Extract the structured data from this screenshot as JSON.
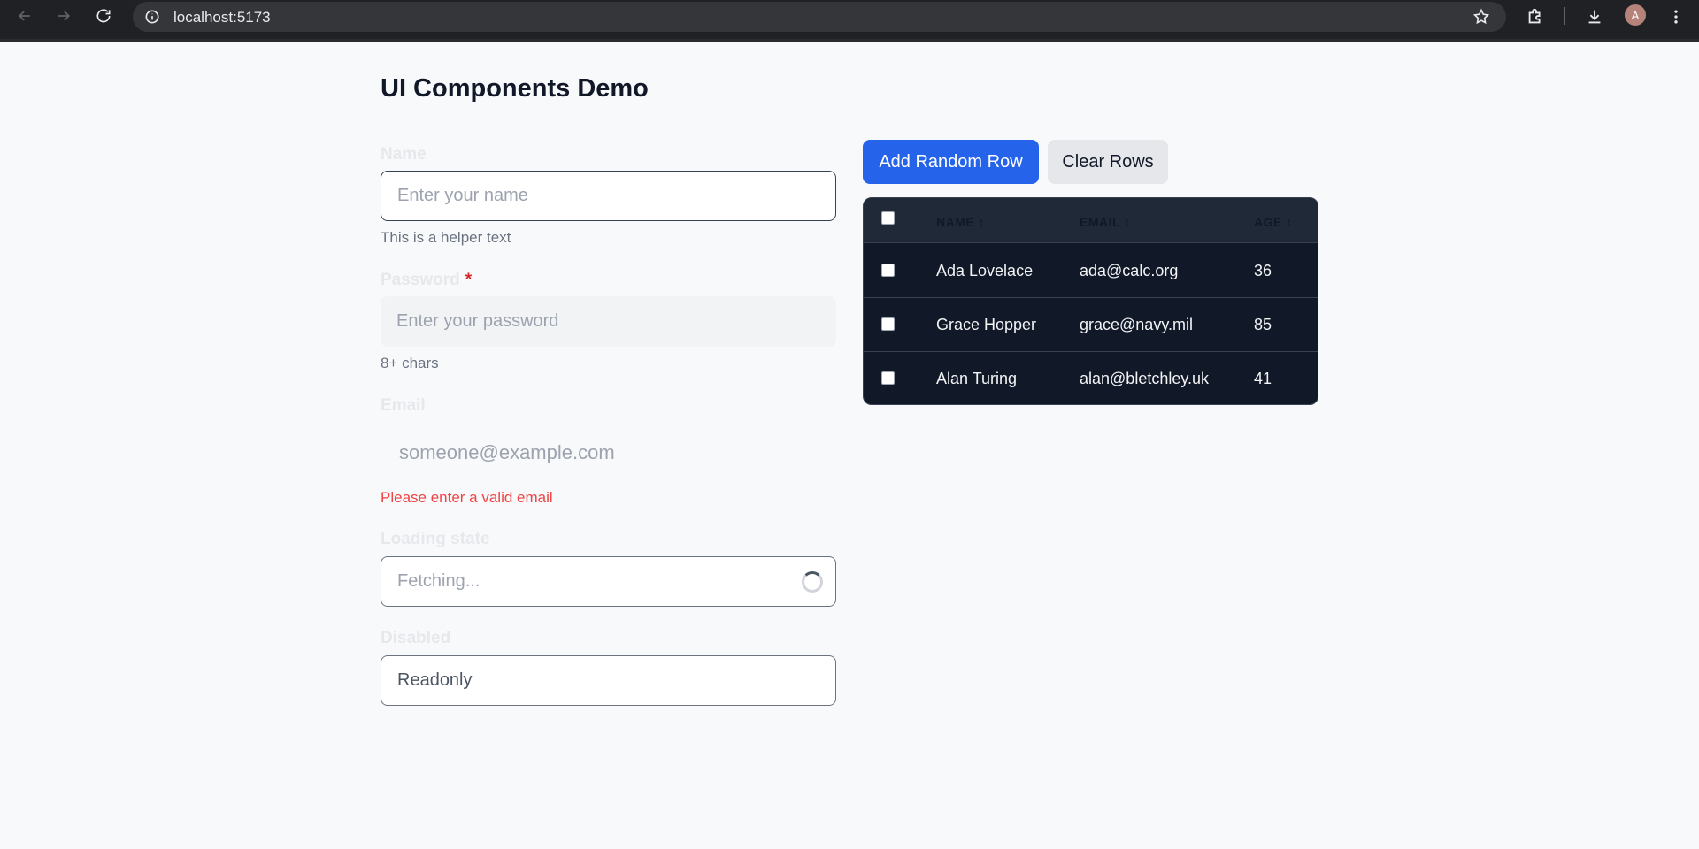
{
  "browser": {
    "url": "localhost:5173",
    "avatar_initial": "A"
  },
  "page": {
    "title": "UI Components Demo"
  },
  "form": {
    "name": {
      "label": "Name",
      "placeholder": "Enter your name",
      "helper": "This is a helper text"
    },
    "password": {
      "label": "Password",
      "required_mark": "*",
      "placeholder": "Enter your password",
      "helper": "8+ chars"
    },
    "email": {
      "label": "Email",
      "placeholder": "someone@example.com",
      "error": "Please enter a valid email"
    },
    "loading": {
      "label": "Loading state",
      "placeholder": "Fetching..."
    },
    "disabled": {
      "label": "Disabled",
      "value": "Readonly"
    }
  },
  "actions": {
    "add_label": "Add Random Row",
    "clear_label": "Clear Rows"
  },
  "table": {
    "headers": [
      "NAME ↕",
      "EMAIL ↕",
      "AGE ↕"
    ],
    "rows": [
      {
        "name": "Ada Lovelace",
        "email": "ada@calc.org",
        "age": "36"
      },
      {
        "name": "Grace Hopper",
        "email": "grace@navy.mil",
        "age": "85"
      },
      {
        "name": "Alan Turing",
        "email": "alan@bletchley.uk",
        "age": "41"
      }
    ]
  },
  "colors": {
    "primary": "#2563eb",
    "error": "#ef4444",
    "table_bg": "#111827"
  }
}
